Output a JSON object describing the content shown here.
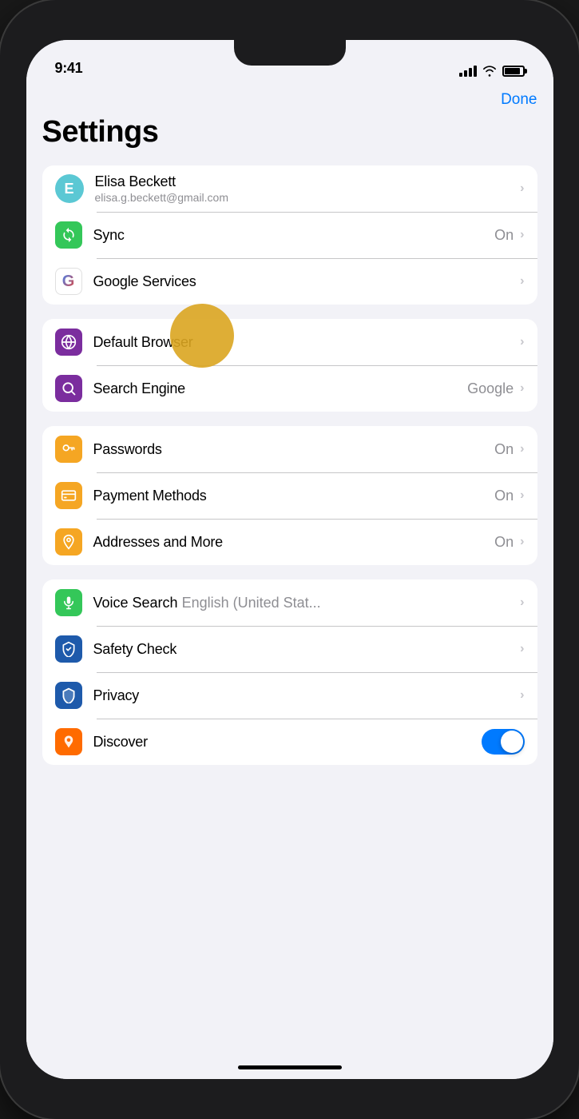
{
  "statusBar": {
    "time": "9:41",
    "batteryLevel": 90
  },
  "header": {
    "doneLabel": "Done",
    "pageTitle": "Settings"
  },
  "groups": [
    {
      "id": "account",
      "rows": [
        {
          "id": "profile",
          "iconType": "avatar",
          "iconLetter": "E",
          "label": "Elisa Beckett",
          "sublabel": "elisa.g.beckett@gmail.com",
          "value": "",
          "hasChevron": true
        },
        {
          "id": "sync",
          "iconType": "colored",
          "iconColor": "#34c759",
          "iconSymbol": "sync",
          "label": "Sync",
          "sublabel": "",
          "value": "On",
          "hasChevron": true
        },
        {
          "id": "google-services",
          "iconType": "google",
          "label": "Google Services",
          "sublabel": "",
          "value": "",
          "hasChevron": true
        }
      ]
    },
    {
      "id": "browser",
      "rows": [
        {
          "id": "default-browser",
          "iconType": "colored",
          "iconColor": "#8b2fc9",
          "iconSymbol": "globe",
          "label": "Default Browser",
          "sublabel": "",
          "value": "",
          "hasChevron": true
        },
        {
          "id": "search-engine",
          "iconType": "colored",
          "iconColor": "#8b2fc9",
          "iconSymbol": "search",
          "label": "Search Engine",
          "sublabel": "",
          "value": "Google",
          "hasChevron": true
        }
      ]
    },
    {
      "id": "autofill",
      "rows": [
        {
          "id": "passwords",
          "iconType": "colored",
          "iconColor": "#f5a623",
          "iconSymbol": "key",
          "label": "Passwords",
          "sublabel": "",
          "value": "On",
          "hasChevron": true
        },
        {
          "id": "payment-methods",
          "iconType": "colored",
          "iconColor": "#f5a623",
          "iconSymbol": "card",
          "label": "Payment Methods",
          "sublabel": "",
          "value": "On",
          "hasChevron": true
        },
        {
          "id": "addresses",
          "iconType": "colored",
          "iconColor": "#f5a623",
          "iconSymbol": "location",
          "label": "Addresses and More",
          "sublabel": "",
          "value": "On",
          "hasChevron": true
        }
      ]
    },
    {
      "id": "other",
      "rows": [
        {
          "id": "voice-search",
          "iconType": "colored",
          "iconColor": "#34c759",
          "iconSymbol": "mic",
          "label": "Voice Search",
          "labelSuffix": "English (United Stat...",
          "sublabel": "",
          "value": "",
          "hasChevron": true
        },
        {
          "id": "safety-check",
          "iconType": "colored",
          "iconColor": "#1e5aab",
          "iconSymbol": "shield-check",
          "label": "Safety Check",
          "sublabel": "",
          "value": "",
          "hasChevron": true
        },
        {
          "id": "privacy",
          "iconType": "colored",
          "iconColor": "#1e5aab",
          "iconSymbol": "shield",
          "label": "Privacy",
          "sublabel": "",
          "value": "",
          "hasChevron": true
        },
        {
          "id": "discover",
          "iconType": "colored",
          "iconColor": "#ff6b00",
          "iconSymbol": "fire",
          "label": "Discover",
          "sublabel": "",
          "value": "",
          "hasToggle": true,
          "toggleOn": true
        }
      ]
    }
  ]
}
